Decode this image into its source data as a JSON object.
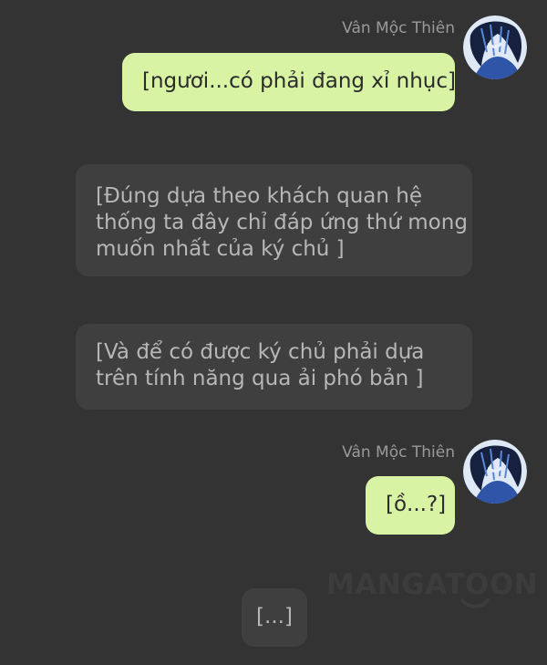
{
  "messages": [
    {
      "sender": "Vân Mộc Thiên",
      "lines": [
        "[ngươi...có phải đang xỉ nhục]"
      ]
    },
    {
      "lines": [
        "[Đúng dựa theo khách quan hệ",
        "thống ta đây chỉ đáp ứng thứ mong",
        "muốn nhất của ký chủ ]"
      ]
    },
    {
      "lines": [
        "[Và để có được ký chủ phải dựa",
        "trên tính năng qua ải phó bản ]"
      ]
    },
    {
      "sender": "Vân Mộc Thiên",
      "lines": [
        "[ồ...?]"
      ]
    },
    {
      "lines": [
        "[...]"
      ]
    }
  ],
  "watermark": {
    "text": "MANGATOON"
  },
  "colors": {
    "background": "#333333",
    "outgoing_bubble": "#d8f3a4",
    "incoming_bubble": "#3f3f3f",
    "incoming_text": "#b7b7b7",
    "sender_name": "#9a9a9a"
  }
}
